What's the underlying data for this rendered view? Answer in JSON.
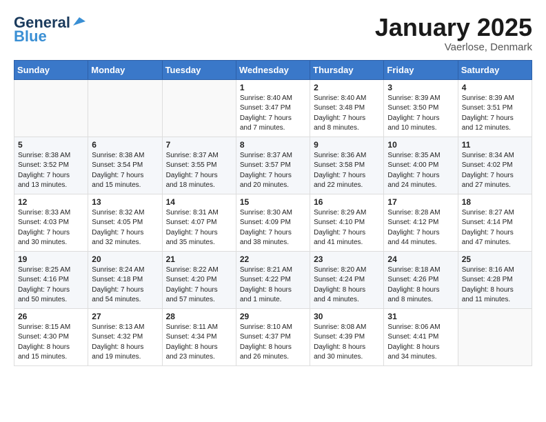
{
  "header": {
    "logo_general": "General",
    "logo_blue": "Blue",
    "month_title": "January 2025",
    "location": "Vaerlose, Denmark"
  },
  "weekdays": [
    "Sunday",
    "Monday",
    "Tuesday",
    "Wednesday",
    "Thursday",
    "Friday",
    "Saturday"
  ],
  "weeks": [
    [
      {
        "day": "",
        "info": ""
      },
      {
        "day": "",
        "info": ""
      },
      {
        "day": "",
        "info": ""
      },
      {
        "day": "1",
        "info": "Sunrise: 8:40 AM\nSunset: 3:47 PM\nDaylight: 7 hours\nand 7 minutes."
      },
      {
        "day": "2",
        "info": "Sunrise: 8:40 AM\nSunset: 3:48 PM\nDaylight: 7 hours\nand 8 minutes."
      },
      {
        "day": "3",
        "info": "Sunrise: 8:39 AM\nSunset: 3:50 PM\nDaylight: 7 hours\nand 10 minutes."
      },
      {
        "day": "4",
        "info": "Sunrise: 8:39 AM\nSunset: 3:51 PM\nDaylight: 7 hours\nand 12 minutes."
      }
    ],
    [
      {
        "day": "5",
        "info": "Sunrise: 8:38 AM\nSunset: 3:52 PM\nDaylight: 7 hours\nand 13 minutes."
      },
      {
        "day": "6",
        "info": "Sunrise: 8:38 AM\nSunset: 3:54 PM\nDaylight: 7 hours\nand 15 minutes."
      },
      {
        "day": "7",
        "info": "Sunrise: 8:37 AM\nSunset: 3:55 PM\nDaylight: 7 hours\nand 18 minutes."
      },
      {
        "day": "8",
        "info": "Sunrise: 8:37 AM\nSunset: 3:57 PM\nDaylight: 7 hours\nand 20 minutes."
      },
      {
        "day": "9",
        "info": "Sunrise: 8:36 AM\nSunset: 3:58 PM\nDaylight: 7 hours\nand 22 minutes."
      },
      {
        "day": "10",
        "info": "Sunrise: 8:35 AM\nSunset: 4:00 PM\nDaylight: 7 hours\nand 24 minutes."
      },
      {
        "day": "11",
        "info": "Sunrise: 8:34 AM\nSunset: 4:02 PM\nDaylight: 7 hours\nand 27 minutes."
      }
    ],
    [
      {
        "day": "12",
        "info": "Sunrise: 8:33 AM\nSunset: 4:03 PM\nDaylight: 7 hours\nand 30 minutes."
      },
      {
        "day": "13",
        "info": "Sunrise: 8:32 AM\nSunset: 4:05 PM\nDaylight: 7 hours\nand 32 minutes."
      },
      {
        "day": "14",
        "info": "Sunrise: 8:31 AM\nSunset: 4:07 PM\nDaylight: 7 hours\nand 35 minutes."
      },
      {
        "day": "15",
        "info": "Sunrise: 8:30 AM\nSunset: 4:09 PM\nDaylight: 7 hours\nand 38 minutes."
      },
      {
        "day": "16",
        "info": "Sunrise: 8:29 AM\nSunset: 4:10 PM\nDaylight: 7 hours\nand 41 minutes."
      },
      {
        "day": "17",
        "info": "Sunrise: 8:28 AM\nSunset: 4:12 PM\nDaylight: 7 hours\nand 44 minutes."
      },
      {
        "day": "18",
        "info": "Sunrise: 8:27 AM\nSunset: 4:14 PM\nDaylight: 7 hours\nand 47 minutes."
      }
    ],
    [
      {
        "day": "19",
        "info": "Sunrise: 8:25 AM\nSunset: 4:16 PM\nDaylight: 7 hours\nand 50 minutes."
      },
      {
        "day": "20",
        "info": "Sunrise: 8:24 AM\nSunset: 4:18 PM\nDaylight: 7 hours\nand 54 minutes."
      },
      {
        "day": "21",
        "info": "Sunrise: 8:22 AM\nSunset: 4:20 PM\nDaylight: 7 hours\nand 57 minutes."
      },
      {
        "day": "22",
        "info": "Sunrise: 8:21 AM\nSunset: 4:22 PM\nDaylight: 8 hours\nand 1 minute."
      },
      {
        "day": "23",
        "info": "Sunrise: 8:20 AM\nSunset: 4:24 PM\nDaylight: 8 hours\nand 4 minutes."
      },
      {
        "day": "24",
        "info": "Sunrise: 8:18 AM\nSunset: 4:26 PM\nDaylight: 8 hours\nand 8 minutes."
      },
      {
        "day": "25",
        "info": "Sunrise: 8:16 AM\nSunset: 4:28 PM\nDaylight: 8 hours\nand 11 minutes."
      }
    ],
    [
      {
        "day": "26",
        "info": "Sunrise: 8:15 AM\nSunset: 4:30 PM\nDaylight: 8 hours\nand 15 minutes."
      },
      {
        "day": "27",
        "info": "Sunrise: 8:13 AM\nSunset: 4:32 PM\nDaylight: 8 hours\nand 19 minutes."
      },
      {
        "day": "28",
        "info": "Sunrise: 8:11 AM\nSunset: 4:34 PM\nDaylight: 8 hours\nand 23 minutes."
      },
      {
        "day": "29",
        "info": "Sunrise: 8:10 AM\nSunset: 4:37 PM\nDaylight: 8 hours\nand 26 minutes."
      },
      {
        "day": "30",
        "info": "Sunrise: 8:08 AM\nSunset: 4:39 PM\nDaylight: 8 hours\nand 30 minutes."
      },
      {
        "day": "31",
        "info": "Sunrise: 8:06 AM\nSunset: 4:41 PM\nDaylight: 8 hours\nand 34 minutes."
      },
      {
        "day": "",
        "info": ""
      }
    ]
  ]
}
